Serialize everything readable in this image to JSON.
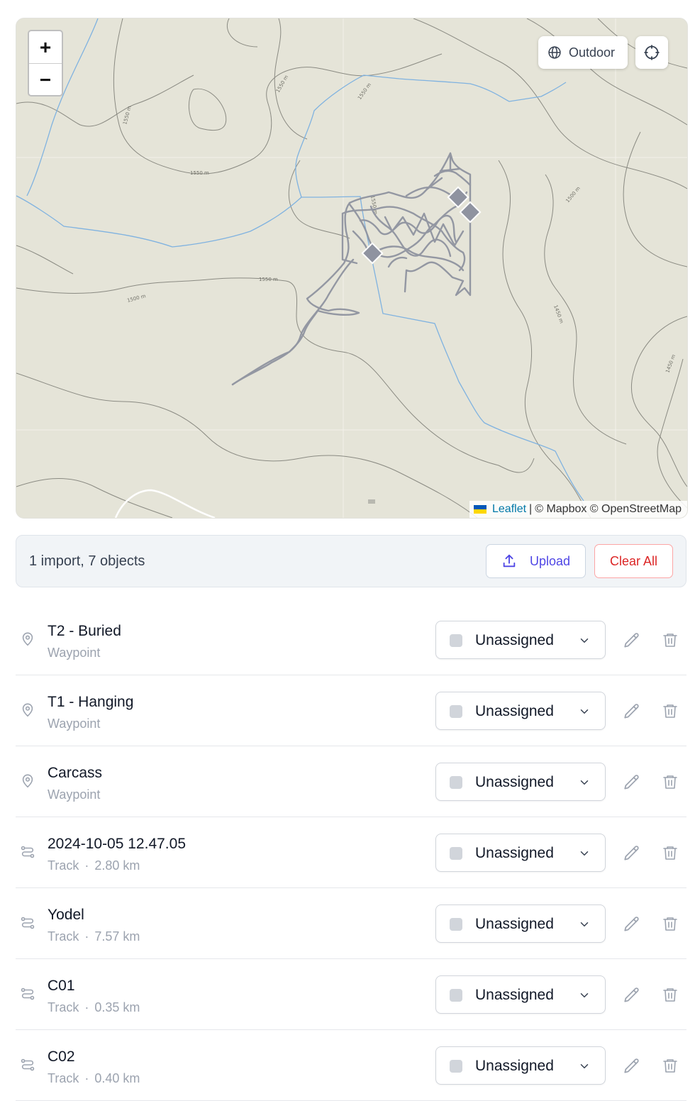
{
  "map": {
    "zoom_in": "+",
    "zoom_out": "−",
    "layer_label": "Outdoor",
    "attribution": {
      "leaflet": "Leaflet",
      "separator": "|",
      "credits": "© Mapbox © OpenStreetMap"
    },
    "contour_labels": [
      "1550 m",
      "1550 m",
      "1550 m",
      "1550 m",
      "1550 m",
      "1550 m",
      "1500 m",
      "1500 m",
      "1450 m",
      "1450 m"
    ],
    "colors": {
      "background": "#e5e4d8",
      "water": "#7fb2e0",
      "contour": "#8a8a82",
      "track": "#8f93a0"
    }
  },
  "import_bar": {
    "summary": "1 import, 7 objects",
    "upload_label": "Upload",
    "clear_label": "Clear All"
  },
  "items": [
    {
      "name": "T2 - Buried",
      "type": "Waypoint",
      "distance": "",
      "group": "Unassigned"
    },
    {
      "name": "T1 - Hanging",
      "type": "Waypoint",
      "distance": "",
      "group": "Unassigned"
    },
    {
      "name": "Carcass",
      "type": "Waypoint",
      "distance": "",
      "group": "Unassigned"
    },
    {
      "name": "2024-10-05 12.47.05",
      "type": "Track",
      "distance": "2.80 km",
      "group": "Unassigned"
    },
    {
      "name": "Yodel",
      "type": "Track",
      "distance": "7.57 km",
      "group": "Unassigned"
    },
    {
      "name": "C01",
      "type": "Track",
      "distance": "0.35 km",
      "group": "Unassigned"
    },
    {
      "name": "C02",
      "type": "Track",
      "distance": "0.40 km",
      "group": "Unassigned"
    }
  ]
}
